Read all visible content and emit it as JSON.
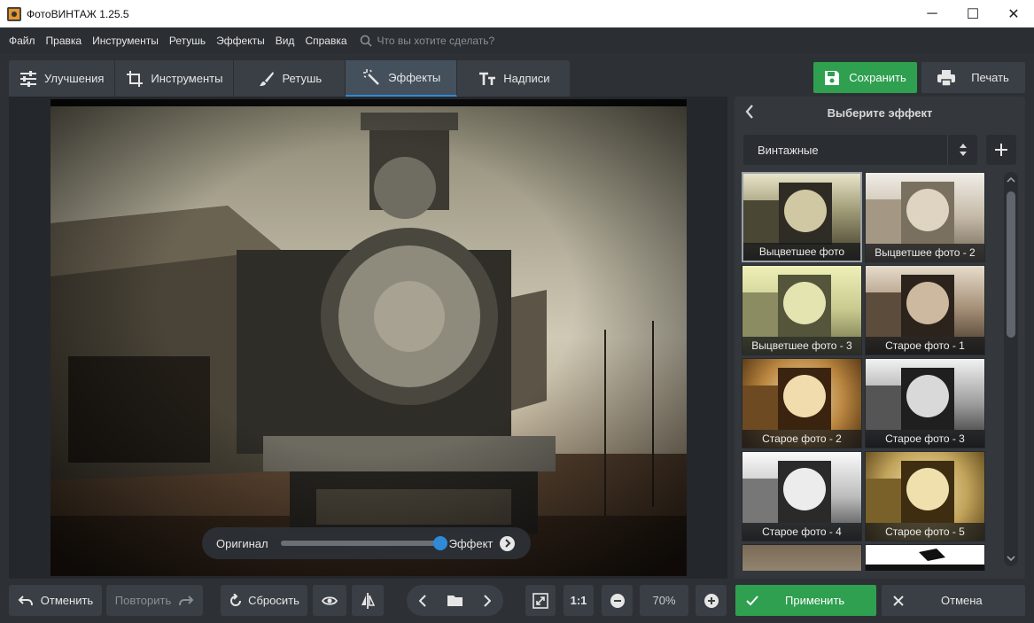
{
  "window": {
    "title": "ФотоВИНТАЖ 1.25.5",
    "minimize": "─",
    "maximize": "☐",
    "close": "✕"
  },
  "menu": {
    "items": [
      "Файл",
      "Правка",
      "Инструменты",
      "Ретушь",
      "Эффекты",
      "Вид",
      "Справка"
    ],
    "search_placeholder": "Что вы хотите сделать?"
  },
  "tabs": [
    {
      "label": "Улучшения",
      "icon": "sliders-icon",
      "active": false
    },
    {
      "label": "Инструменты",
      "icon": "crop-icon",
      "active": false
    },
    {
      "label": "Ретушь",
      "icon": "brush-icon",
      "active": false
    },
    {
      "label": "Эффекты",
      "icon": "magic-wand-icon",
      "active": true
    },
    {
      "label": "Надписи",
      "icon": "text-icon",
      "active": false
    }
  ],
  "actions": {
    "save_label": "Сохранить",
    "print_label": "Печать"
  },
  "compare": {
    "original_label": "Оригинал",
    "effect_label": "Эффект",
    "position": 1.0
  },
  "panel": {
    "title": "Выберите эффект",
    "category": "Винтажные",
    "effects": [
      {
        "label": "Выцветшее фото",
        "selected": true
      },
      {
        "label": "Выцветшее фото - 2",
        "selected": false
      },
      {
        "label": "Выцветшее фото - 3",
        "selected": false
      },
      {
        "label": "Старое фото - 1",
        "selected": false
      },
      {
        "label": "Старое фото - 2",
        "selected": false
      },
      {
        "label": "Старое фото - 3",
        "selected": false
      },
      {
        "label": "Старое фото - 4",
        "selected": false
      },
      {
        "label": "Старое фото - 5",
        "selected": false
      },
      {
        "label": "",
        "selected": false
      },
      {
        "label": "",
        "selected": false
      }
    ]
  },
  "bottom": {
    "undo_label": "Отменить",
    "redo_label": "Повторить",
    "reset_label": "Сбросить",
    "zoom_actual": "1:1",
    "zoom_value": "70%",
    "apply_label": "Применить",
    "cancel_label": "Отмена"
  },
  "colors": {
    "accent_green": "#2ea04f",
    "accent_blue": "#2f8ad8",
    "background": "#2d3135"
  }
}
